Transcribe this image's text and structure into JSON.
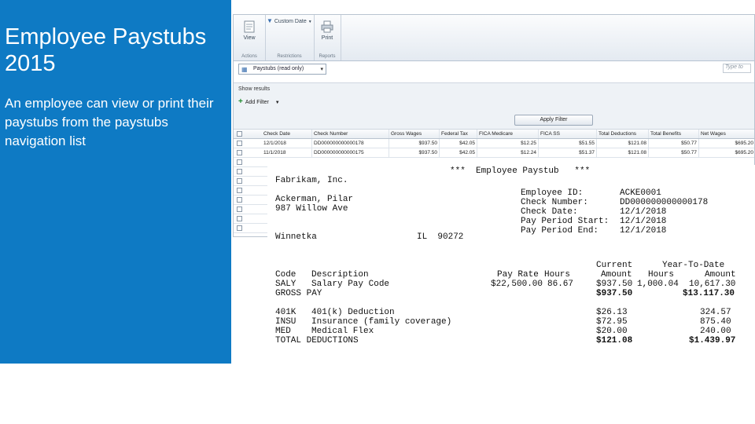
{
  "slide": {
    "title_line1": "Employee Paystubs",
    "title_line2": "2015",
    "description": "An employee can view or print their paystubs from the paystubs navigation list"
  },
  "ribbon": {
    "view_label": "View",
    "custom_date_label": "Custom Date",
    "print_label": "Print",
    "group_actions": "Actions",
    "group_restrictions": "Restrictions",
    "group_reports": "Reports"
  },
  "toolbar": {
    "view_select_value": "Paystubs (read only)",
    "search_placeholder": "Type to"
  },
  "filter": {
    "show_results": "Show results",
    "add_filter": "Add Filter",
    "apply_filter": "Apply Filter"
  },
  "grid": {
    "columns": [
      "Check Date",
      "Check Number",
      "Gross Wages",
      "Federal Tax",
      "FICA Medicare",
      "FICA SS",
      "Total Deductions",
      "Total Benefits",
      "Net Wages"
    ],
    "rows": [
      [
        "12/1/2018",
        "DD000000000000178",
        "$937.50",
        "$42.05",
        "$12.25",
        "$51.55",
        "$121.08",
        "$50.77",
        "$695.20"
      ],
      [
        "11/1/2018",
        "DD000000000000175",
        "$937.50",
        "$42.05",
        "$12.24",
        "$51.37",
        "$121.08",
        "$50.77",
        "$695.20"
      ]
    ]
  },
  "paystub": {
    "header": "***  Employee Paystub   ***",
    "company": "Fabrikam, Inc.",
    "employee_name": "Ackerman, Pilar",
    "address": "987 Willow Ave",
    "city": "Winnetka",
    "state_zip": "IL  90272",
    "employee_id_label": "Employee ID:",
    "employee_id": "ACKE0001",
    "check_number_label": "Check Number:",
    "check_number": "DD000000000000178",
    "check_date_label": "Check Date:",
    "check_date": "12/1/2018",
    "pay_period_start_label": "Pay Period Start:",
    "pay_period_start": "12/1/2018",
    "pay_period_end_label": "Pay Period End:",
    "pay_period_end": "12/1/2018",
    "col_current": "Current",
    "col_ytd": "Year-To-Date",
    "col_code": "Code",
    "col_description": "Description",
    "col_pay_rate": "Pay Rate",
    "col_hours": "Hours",
    "col_amount": "Amount",
    "col_hours2": "Hours",
    "col_amount2": "Amount",
    "earnings": [
      {
        "code": "SALY",
        "description": "Salary Pay Code",
        "pay_rate": "$22,500.00",
        "hours": "86.67",
        "amount": "$937.50",
        "ytd_hours": "1,000.04",
        "ytd_amount": "10,617.30"
      }
    ],
    "gross_pay_label": "GROSS PAY",
    "gross_pay": "$937.50",
    "gross_pay_ytd": "$13.117.30",
    "deductions": [
      {
        "code": "401K",
        "description": "401(k) Deduction",
        "amount": "$26.13",
        "ytd": "324.57"
      },
      {
        "code": "INSU",
        "description": "Insurance (family coverage)",
        "amount": "$72.95",
        "ytd": "875.40"
      },
      {
        "code": "MED",
        "description": "Medical Flex",
        "amount": "$20.00",
        "ytd": "240.00"
      }
    ],
    "total_deductions_label": "TOTAL DEDUCTIONS",
    "total_deductions": "$121.08",
    "total_deductions_ytd": "$1.439.97"
  }
}
